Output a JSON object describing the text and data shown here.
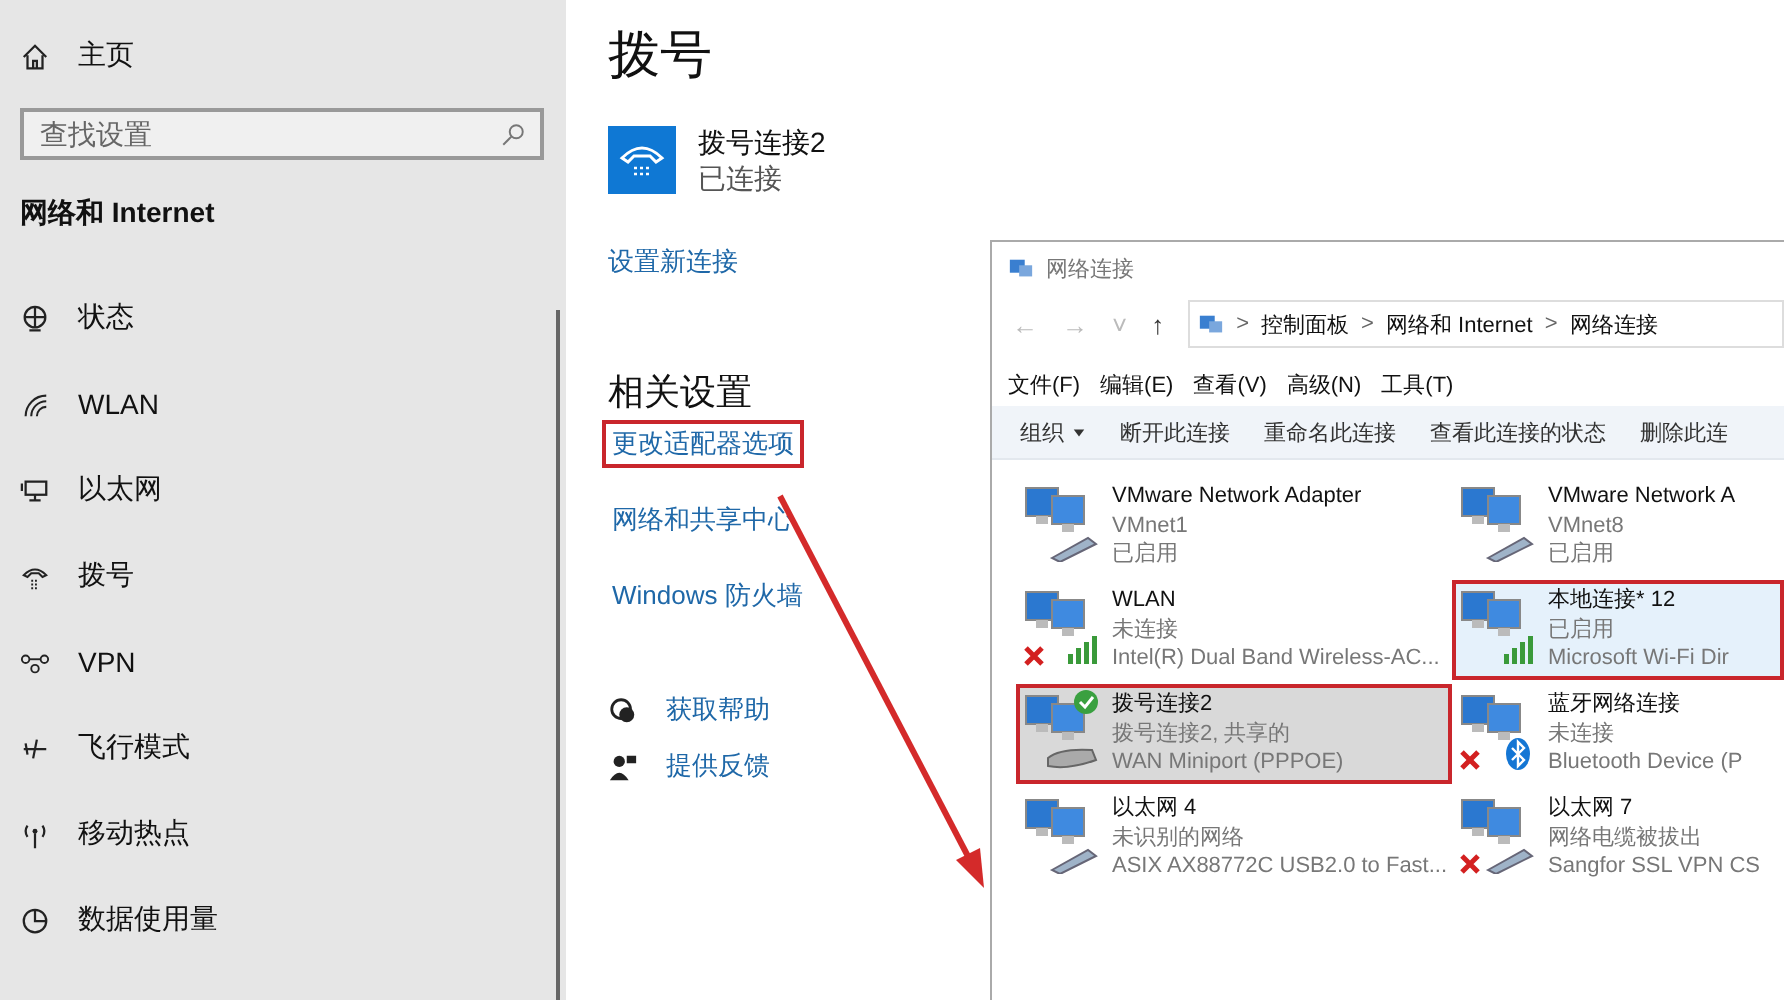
{
  "sidebar": {
    "home": "主页",
    "search": {
      "placeholder": "查找设置"
    },
    "heading": "网络和 Internet",
    "items": [
      {
        "label": "状态"
      },
      {
        "label": "WLAN"
      },
      {
        "label": "以太网"
      },
      {
        "label": "拨号"
      },
      {
        "label": "VPN"
      },
      {
        "label": "飞行模式"
      },
      {
        "label": "移动热点"
      },
      {
        "label": "数据使用量"
      }
    ]
  },
  "main": {
    "title": "拨号",
    "connection": {
      "name": "拨号连接2",
      "status": "已连接"
    },
    "new_link": "设置新连接",
    "related_heading": "相关设置",
    "related_links": [
      {
        "label": "更改适配器选项",
        "annotated": true
      },
      {
        "label": "网络和共享中心",
        "annotated": false
      },
      {
        "label": "Windows 防火墙",
        "annotated": false
      }
    ],
    "help": [
      {
        "label": "获取帮助"
      },
      {
        "label": "提供反馈"
      }
    ]
  },
  "explorer": {
    "title": "网络连接",
    "nav": [
      "←",
      "→",
      "˅",
      "↑"
    ],
    "breadcrumb": [
      "控制面板",
      "网络和 Internet",
      "网络连接"
    ],
    "separator": ">",
    "menu": [
      "文件(F)",
      "编辑(E)",
      "查看(V)",
      "高级(N)",
      "工具(T)"
    ],
    "toolbar": [
      {
        "label": "组织",
        "dropdown": true
      },
      {
        "label": "断开此连接",
        "dropdown": false
      },
      {
        "label": "重命名此连接",
        "dropdown": false
      },
      {
        "label": "查看此连接的状态",
        "dropdown": false
      },
      {
        "label": "删除此连",
        "dropdown": false
      }
    ],
    "connections": [
      {
        "name": "VMware Network Adapter",
        "lines": [
          "VMnet1",
          "已启用"
        ],
        "kind": "cable",
        "error": false,
        "connected": false,
        "selected": false,
        "hovered": false,
        "annotated": false
      },
      {
        "name": "VMware Network A",
        "lines": [
          "VMnet8",
          "已启用"
        ],
        "kind": "cable",
        "error": false,
        "connected": false,
        "selected": false,
        "hovered": false,
        "annotated": false
      },
      {
        "name": "WLAN",
        "lines": [
          "未连接",
          "Intel(R) Dual Band Wireless-AC..."
        ],
        "kind": "wireless",
        "error": true,
        "connected": false,
        "selected": false,
        "hovered": false,
        "annotated": false
      },
      {
        "name": "本地连接* 12",
        "lines": [
          "已启用",
          "Microsoft Wi-Fi Dir"
        ],
        "kind": "wireless",
        "error": false,
        "connected": false,
        "selected": false,
        "hovered": true,
        "annotated": true
      },
      {
        "name": "拨号连接2",
        "lines": [
          "拨号连接2, 共享的",
          "WAN Miniport (PPPOE)"
        ],
        "kind": "modem",
        "error": false,
        "connected": true,
        "selected": true,
        "hovered": false,
        "annotated": true
      },
      {
        "name": "蓝牙网络连接",
        "lines": [
          "未连接",
          "Bluetooth Device (P"
        ],
        "kind": "bluetooth",
        "error": true,
        "connected": false,
        "selected": false,
        "hovered": false,
        "annotated": false
      },
      {
        "name": "以太网 4",
        "lines": [
          "未识别的网络",
          "ASIX AX88772C USB2.0 to Fast..."
        ],
        "kind": "cable",
        "error": false,
        "connected": false,
        "selected": false,
        "hovered": false,
        "annotated": false
      },
      {
        "name": "以太网 7",
        "lines": [
          "网络电缆被拔出",
          "Sangfor SSL VPN CS"
        ],
        "kind": "cable",
        "error": true,
        "connected": false,
        "selected": false,
        "hovered": false,
        "annotated": false
      }
    ]
  }
}
